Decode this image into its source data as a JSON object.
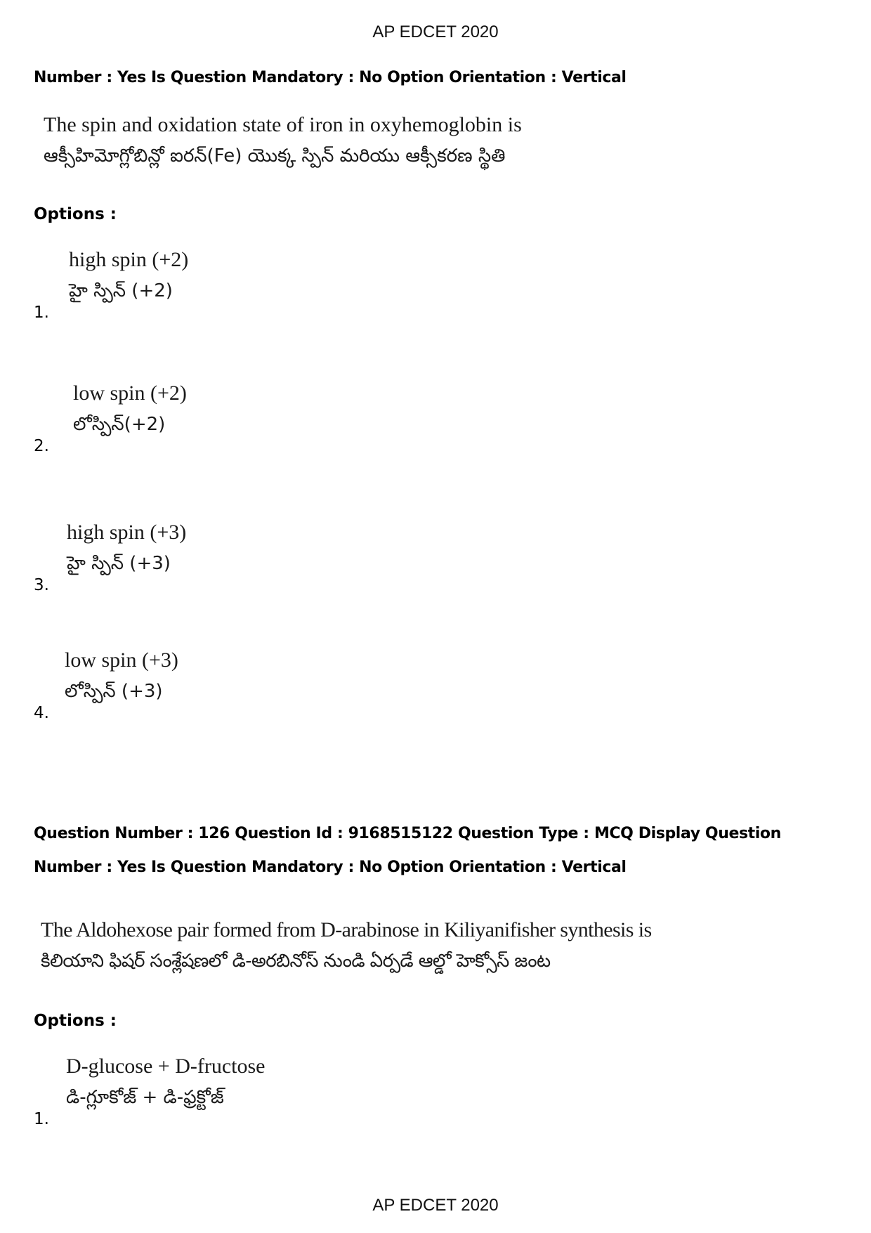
{
  "header": {
    "title": "AP EDCET 2020"
  },
  "footer": {
    "title": "AP EDCET 2020"
  },
  "question_125": {
    "meta_line_2": "Number : Yes Is Question Mandatory : No Option Orientation : Vertical",
    "text_en": "The spin and oxidation state of iron in oxyhemoglobin is",
    "text_te": "ఆక్సీహిమోగ్లోబిన్లో ఐరన్(Fe) యొక్క స్పిన్ మరియు ఆక్సీకరణ స్థితి",
    "options_label": "Options :",
    "options": [
      {
        "number": "1.",
        "en": "high spin (+2)",
        "te": "హై స్పిన్ (+2)"
      },
      {
        "number": "2.",
        "en": "low spin (+2)",
        "te": "లోస్పిన్(+2)"
      },
      {
        "number": "3.",
        "en": "high spin (+3)",
        "te": "హై స్పిన్ (+3)"
      },
      {
        "number": "4.",
        "en": "low spin (+3)",
        "te": "లోస్పిన్ (+3)"
      }
    ]
  },
  "question_126": {
    "meta_line_1": "Question Number : 126 Question Id : 9168515122 Question Type : MCQ Display Question",
    "meta_line_2": "Number : Yes Is Question Mandatory : No Option Orientation : Vertical",
    "text_en": "The Aldohexose  pair formed from D-arabinose in Kiliyanifisher synthesis is",
    "text_te": "కిలియాని ఫిషర్ సంశ్లేషణలో డి-అరబినోస్ నుండి ఏర్పడే ఆల్డో హెక్సోస్ జంట",
    "options_label": "Options :",
    "options": [
      {
        "number": "1.",
        "en": "D-glucose + D-fructose",
        "te": "డి-గ్లూకోజ్ + డి-ఫ్రక్టోజ్"
      }
    ]
  }
}
